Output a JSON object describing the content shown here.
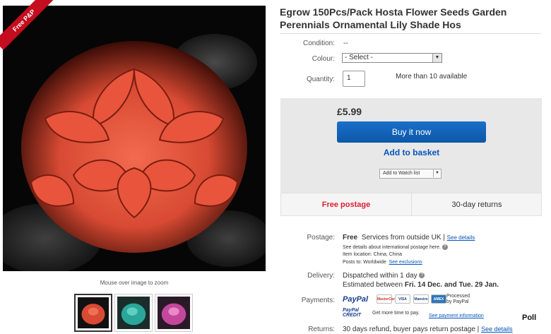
{
  "image": {
    "ribbon": "Free P&P",
    "zoom_hint": "Mouse over image to zoom"
  },
  "item": {
    "title": "Egrow 150Pcs/Pack Hosta Flower Seeds Garden Perennials Ornamental Lily Shade Hos",
    "condition_label": "Condition:",
    "condition_value": "--",
    "color_label": "Colour:",
    "color_selected": "- Select -",
    "quantity_label": "Quantity:",
    "quantity_value": "1",
    "availability": "More than 10 available"
  },
  "buy": {
    "price": "£5.99",
    "buy_now": "Buy it now",
    "add_basket": "Add to basket",
    "watch_list": "Add to Watch list",
    "free_postage": "Free postage",
    "returns": "30-day returns"
  },
  "details": {
    "postage_label": "Postage:",
    "postage_free": "Free",
    "postage_service": "Services from outside UK |",
    "see_details": "See details",
    "intl_note": "See details about international postage here.",
    "item_location": "Item location:  China, China",
    "posts_to": "Posts to:  Worldwide",
    "see_exclusions": "See exclusions",
    "delivery_label": "Delivery:",
    "dispatched": "Dispatched within 1 day",
    "estimated_prefix": "Estimated between",
    "estimated_dates": "Fri. 14 Dec. and Tue. 29 Jan.",
    "payments_label": "Payments:",
    "paypal": "PayPal",
    "processed": "Processed by PayPal",
    "paypal_credit": "PayPal CREDIT",
    "more_time": "Get more time to pay.",
    "see_payment": "See payment information",
    "returns_label": "Returns:",
    "returns_text": "30 days refund, buyer pays return postage |",
    "returns_see": "See details"
  },
  "cards": [
    "MasterCard",
    "VISA",
    "Maestro",
    "AMEX"
  ],
  "poll": "Poll",
  "colors": {
    "accent_blue": "#0654ba",
    "buy_blue": "#1567c2",
    "free_red": "#dd1e31",
    "ribbon_red": "#c40d1e"
  }
}
